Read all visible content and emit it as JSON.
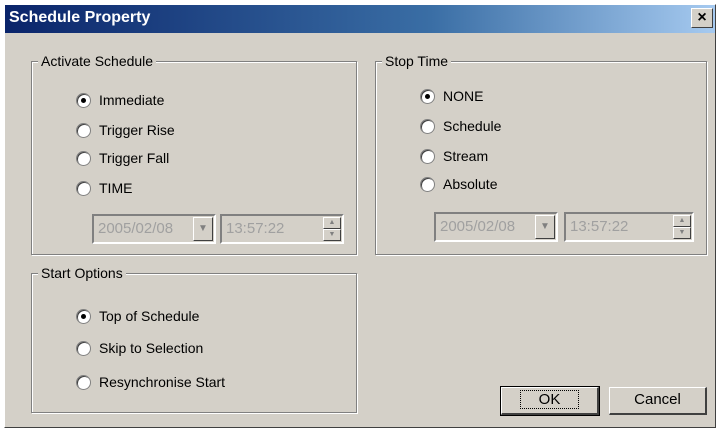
{
  "dialog": {
    "title": "Schedule Property",
    "close_glyph": "×"
  },
  "activate_schedule": {
    "legend": "Activate Schedule",
    "options": [
      "Immediate",
      "Trigger Rise",
      "Trigger Fall",
      "TIME"
    ],
    "selected": "Immediate",
    "date_value": "2005/02/08",
    "time_value": "13:57:22"
  },
  "stop_time": {
    "legend": "Stop Time",
    "options": [
      "NONE",
      "Schedule",
      "Stream",
      "Absolute"
    ],
    "selected": "NONE",
    "date_value": "2005/02/08",
    "time_value": "13:57:22"
  },
  "start_options": {
    "legend": "Start Options",
    "options": [
      "Top of Schedule",
      "Skip to Selection",
      "Resynchronise Start"
    ],
    "selected": "Top of Schedule"
  },
  "buttons": {
    "ok": "OK",
    "cancel": "Cancel"
  },
  "icons": {
    "dropdown": "▼",
    "spin_up": "▲",
    "spin_down": "▼"
  }
}
